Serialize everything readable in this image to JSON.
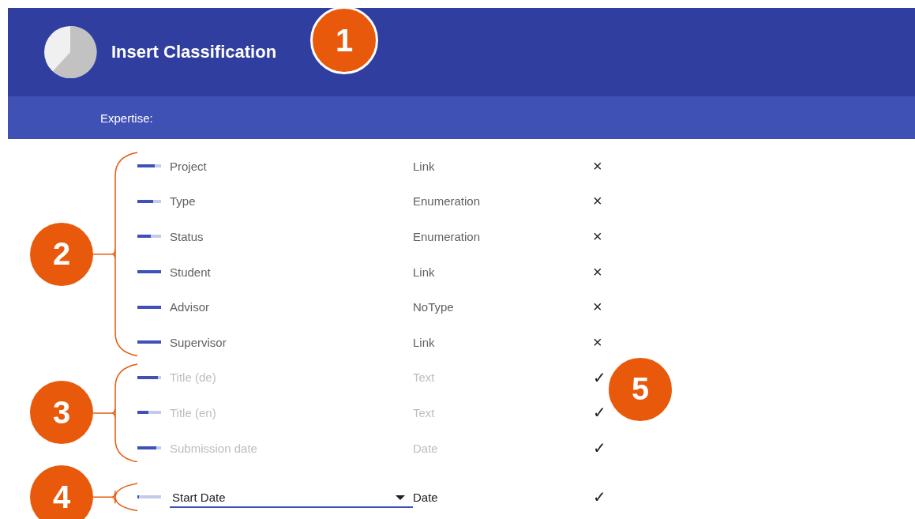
{
  "header": {
    "title": "Insert Classification",
    "callout": "1"
  },
  "subheader": {
    "label": "Expertise:"
  },
  "groups": [
    {
      "callout": "2",
      "rows": [
        {
          "kind": "text",
          "label": "Project",
          "type": "Link",
          "mark": "×",
          "disabled": false,
          "level": 0.72
        },
        {
          "kind": "text",
          "label": "Type",
          "type": "Enumeration",
          "mark": "×",
          "disabled": false,
          "level": 0.68
        },
        {
          "kind": "text",
          "label": "Status",
          "type": "Enumeration",
          "mark": "×",
          "disabled": false,
          "level": 0.55
        },
        {
          "kind": "text",
          "label": "Student",
          "type": "Link",
          "mark": "×",
          "disabled": false,
          "level": 1
        },
        {
          "kind": "text",
          "label": "Advisor",
          "type": "NoType",
          "mark": "×",
          "disabled": false,
          "level": 1
        },
        {
          "kind": "text",
          "label": "Supervisor",
          "type": "Link",
          "mark": "×",
          "disabled": false,
          "level": 1
        }
      ]
    },
    {
      "callout": "3",
      "side_callout": "5",
      "rows": [
        {
          "kind": "text",
          "label": "Title (de)",
          "type": "Text",
          "mark": "✓",
          "disabled": true,
          "level": 0.85
        },
        {
          "kind": "text",
          "label": "Title (en)",
          "type": "Text",
          "mark": "✓",
          "disabled": true,
          "level": 0.48
        },
        {
          "kind": "text",
          "label": "Submission date",
          "type": "Date",
          "mark": "✓",
          "disabled": true,
          "level": 0.8
        }
      ]
    },
    {
      "callout": "4",
      "rows": [
        {
          "kind": "dropdown",
          "label": "Start Date",
          "type": "Date",
          "mark": "✓",
          "disabled": false,
          "level": 0.05
        }
      ]
    }
  ]
}
